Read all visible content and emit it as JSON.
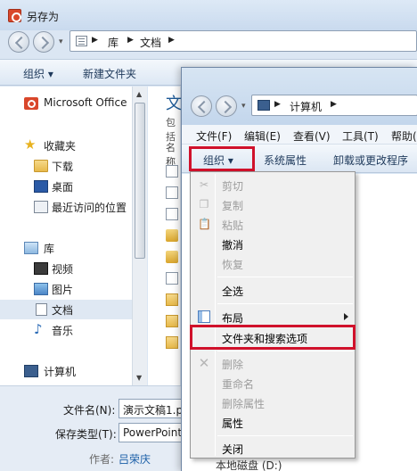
{
  "save_as": {
    "title": "另存为",
    "breadcrumb": [
      "库",
      "文档"
    ],
    "toolbar": {
      "organize": "组织",
      "new_folder": "新建文件夹"
    },
    "nav": [
      {
        "label": "Microsoft Office",
        "icon": "office-icon"
      },
      {
        "label": "收藏夹",
        "icon": "star-icon"
      },
      {
        "label": "下载",
        "icon": "downloads-folder-icon"
      },
      {
        "label": "桌面",
        "icon": "desktop-icon"
      },
      {
        "label": "最近访问的位置",
        "icon": "recent-places-icon"
      },
      {
        "label": "库",
        "icon": "library-icon"
      },
      {
        "label": "视频",
        "icon": "video-icon"
      },
      {
        "label": "图片",
        "icon": "pictures-icon"
      },
      {
        "label": "文档",
        "icon": "documents-icon"
      },
      {
        "label": "音乐",
        "icon": "music-icon"
      },
      {
        "label": "计算机",
        "icon": "computer-icon"
      }
    ],
    "content": {
      "heading": "文",
      "sub": "包括",
      "column": "名称"
    },
    "filename_label": "文件名(N):",
    "filename_value": "演示文稿1.p",
    "filetype_label": "保存类型(T):",
    "filetype_value": "PowerPoint",
    "author_label": "作者:",
    "author_value": "吕荣庆"
  },
  "computer": {
    "breadcrumb": "计算机",
    "menu": [
      "文件(F)",
      "编辑(E)",
      "查看(V)",
      "工具(T)",
      "帮助(H)"
    ],
    "commands": {
      "organize": "组织",
      "system_properties": "系统属性",
      "uninstall": "卸载或更改程序"
    },
    "drive_label": "本地磁盘 (D:)"
  },
  "organize_menu": {
    "items": [
      {
        "label": "剪切",
        "enabled": false,
        "icon": "scissors-icon"
      },
      {
        "label": "复制",
        "enabled": false,
        "icon": "copy-icon"
      },
      {
        "label": "粘贴",
        "enabled": false,
        "icon": "paste-icon"
      },
      {
        "label": "撤消",
        "enabled": true
      },
      {
        "label": "恢复",
        "enabled": false
      },
      {
        "label": "全选",
        "enabled": true
      },
      {
        "label": "布局",
        "enabled": true,
        "icon": "layout-icon",
        "submenu": true
      },
      {
        "label": "文件夹和搜索选项",
        "enabled": true
      },
      {
        "label": "删除",
        "enabled": false,
        "icon": "delete-x-icon"
      },
      {
        "label": "重命名",
        "enabled": false
      },
      {
        "label": "删除属性",
        "enabled": false
      },
      {
        "label": "属性",
        "enabled": true
      },
      {
        "label": "关闭",
        "enabled": true
      }
    ]
  },
  "colors": {
    "highlight_red": "#d0112b",
    "link_blue": "#1b5fa8"
  }
}
